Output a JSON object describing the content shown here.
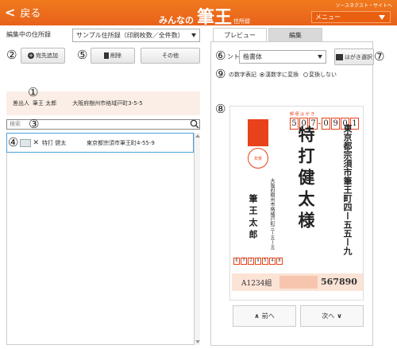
{
  "header": {
    "back_label": "戻る",
    "logo_pre": "みんなの",
    "logo_big": "筆王",
    "logo_post": "住所録",
    "source_link": "ソースネクスト・サイトへ",
    "menu_label": "メニュー"
  },
  "left": {
    "editing_label": "編集中の住所録",
    "addressbook_select": "サンプル住所録（印刷枚数／全件数）",
    "btn_add": "宛先追加",
    "btn_delete": "削除",
    "btn_other": "その他",
    "sender_prefix": "差出人",
    "sender_name": "筆王 太郎",
    "sender_address": "大阪府樹州市格域戸町3-5-5",
    "search_placeholder": "検索",
    "list_items": [
      {
        "name": "特打 健太",
        "address": "東京都宗須市筆王町4-55-9"
      }
    ]
  },
  "right": {
    "tab_preview": "プレビュー",
    "tab_edit": "編集",
    "font_label": "ント",
    "font_select": "楷書体",
    "hagaki_btn": "はがき選択",
    "numeral_label": "の数字表記",
    "radio_convert": "漢数字に変換",
    "radio_noconvert": "変換しない",
    "prev_label": "前へ",
    "next_label": "次へ"
  },
  "postcard": {
    "zip_label": "郵 便 は が き",
    "zip_digits": [
      "5",
      "0",
      "7",
      "0",
      "9",
      "0",
      "1"
    ],
    "recipient_address_1": "東京都宗須市筆王町四ー五五ー九",
    "recipient_name": "特打健太様",
    "sender_address": "大阪府樹州市格域戸町三ー五ー五",
    "sender_name": "筆王太郎",
    "sender_zip": [
      "6",
      "7",
      "2",
      "9",
      "5",
      "4",
      "8"
    ],
    "postmark_text": "年賀",
    "band_left": "A1234組",
    "band_right": "567890"
  },
  "annotations": [
    "①",
    "②",
    "③",
    "④",
    "⑤",
    "⑥",
    "⑦",
    "⑧",
    "⑨"
  ],
  "colors": {
    "header": "#e8621a",
    "accent_red": "#e8421a",
    "selection_blue": "#4aa3df"
  }
}
